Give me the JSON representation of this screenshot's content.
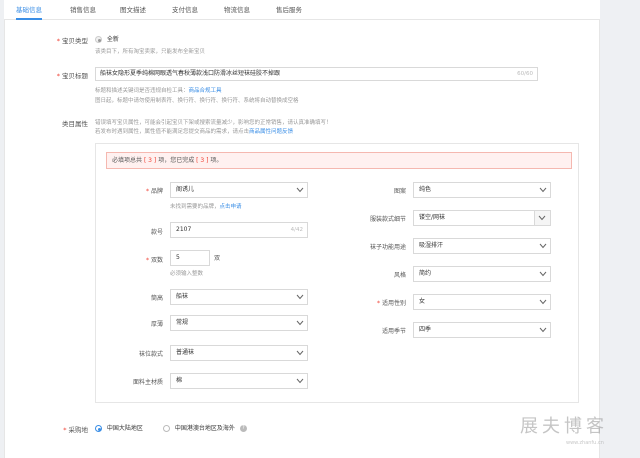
{
  "tabs": [
    "基础信息",
    "销售信息",
    "图文描述",
    "支付信息",
    "物流信息",
    "售后服务"
  ],
  "item_type": {
    "label": "宝贝类型",
    "option": "全新",
    "hint": "该类目下，所有淘宝卖家，只能发布全新宝贝"
  },
  "item_title": {
    "label": "宝贝标题",
    "value": "船袜女隐形夏季纯棉网眼透气春秋薄款浅口防滑冰丝短袜硅胶不掉跟",
    "counter": "60/60",
    "hint1_prefix": "标题和描述关键词是否违规自检工具：",
    "hint1_link": "商品合规工具",
    "hint2": "图日起，标题中请勿使用制表符、换行符、换行符、换行符、系统将自动替换成空格"
  },
  "category_attr": {
    "label": "类目属性",
    "hint1": "错误填写宝贝属性，可能会引起宝贝下架或搜索流量减少，影响您的正常销售，请认真准确填写！",
    "hint2_prefix": "若发布时遇到属性，属性值不能满足您提交商品的需求，请点击",
    "hint2_link": "商品属性问题反馈",
    "notice_prefix": "必填项总共",
    "notice_total": "[ 3 ]",
    "notice_mid": "项，您已完成",
    "notice_done": "[ 3 ]",
    "notice_suffix": "项。"
  },
  "fields": {
    "brand": {
      "label": "品牌",
      "value": "阁诱儿",
      "hint_prefix": "未找到需要的品牌，",
      "hint_link": "点击申请"
    },
    "model": {
      "label": "款号",
      "value": "2107",
      "counter": "4/42"
    },
    "pairs": {
      "label": "双数",
      "value": "5",
      "unit": "双",
      "hint": "必须输入整数"
    },
    "tube_height": {
      "label": "筒高",
      "value": "船袜"
    },
    "thickness": {
      "label": "厚薄",
      "value": "常规"
    },
    "heel_style": {
      "label": "袜位款式",
      "value": "普通袜"
    },
    "main_material": {
      "label": "面料主材质",
      "value": "棉"
    },
    "pattern": {
      "label": "图案",
      "value": "纯色"
    },
    "detail": {
      "label": "服装款式细节",
      "value": "镂空/网袜"
    },
    "function": {
      "label": "袜子功能用途",
      "value": "吸湿排汗"
    },
    "style": {
      "label": "风格",
      "value": "简约"
    },
    "gender": {
      "label": "适用性别",
      "value": "女"
    },
    "season": {
      "label": "适用季节",
      "value": "四季"
    }
  },
  "purchase": {
    "label": "采购地",
    "option1": "中国大陆地区",
    "option2": "中国港澳台地区及海外",
    "help": "?"
  },
  "watermark": {
    "main": "展夫博客",
    "sub": "www.zhanfu.cn"
  }
}
